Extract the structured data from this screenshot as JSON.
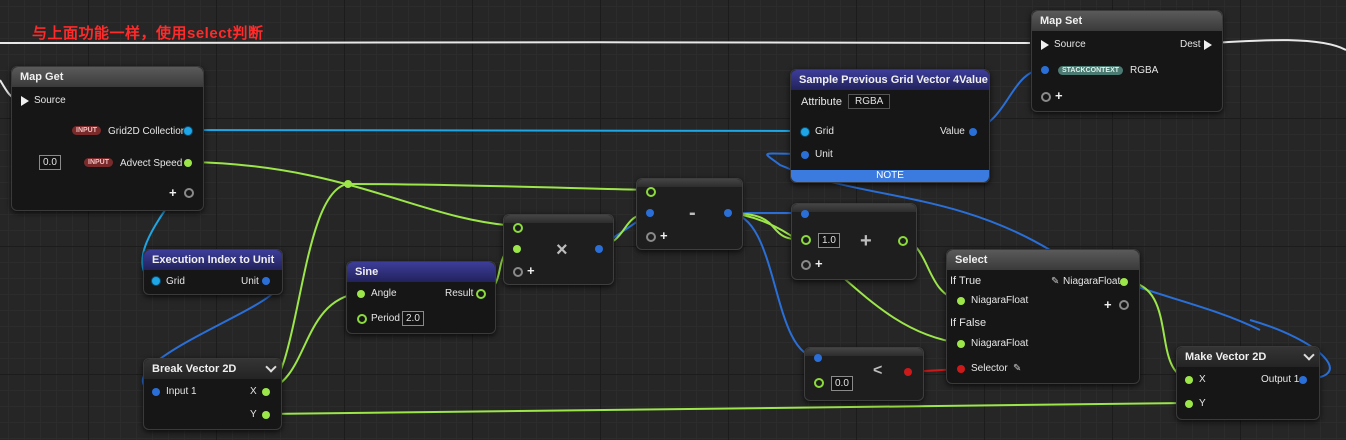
{
  "comment": "与上面功能一样，使用select判断",
  "map_get": {
    "title": "Map Get",
    "source": "Source",
    "input_badge": "INPUT",
    "grid_collection": "Grid2D Collection",
    "advect_speed": "Advect Speed",
    "advect_value": "0.0"
  },
  "exec_index": {
    "title": "Execution Index to Unit",
    "grid": "Grid",
    "unit": "Unit"
  },
  "break_vector": {
    "title": "Break Vector 2D",
    "input": "Input 1",
    "x": "X",
    "y": "Y"
  },
  "sine": {
    "title": "Sine",
    "angle": "Angle",
    "result": "Result",
    "period": "Period",
    "period_value": "2.0"
  },
  "multiply": {
    "symbol": "×"
  },
  "subtract": {
    "symbol": "-"
  },
  "add": {
    "symbol": "+",
    "value": "1.0"
  },
  "less": {
    "symbol": "<",
    "value": "0.0"
  },
  "sample": {
    "title": "Sample Previous Grid Vector 4Value",
    "attribute_label": "Attribute",
    "attribute_value": "RGBA",
    "grid": "Grid",
    "unit": "Unit",
    "value": "Value",
    "note": "NOTE"
  },
  "map_set": {
    "title": "Map Set",
    "source": "Source",
    "dest": "Dest",
    "stack_badge": "STACKCONTEXT",
    "rgba": "RGBA"
  },
  "select": {
    "title": "Select",
    "if_true": "If True",
    "if_false": "If False",
    "niagara_float": "NiagaraFloat",
    "selector": "Selector"
  },
  "make_vector": {
    "title": "Make Vector 2D",
    "x": "X",
    "y": "Y",
    "output": "Output 1"
  },
  "colors": {
    "float_pin": "#9ce64a",
    "struct_pin": "#1ea6e6",
    "bool_pin": "#cc1a1a",
    "comment_text": "#ff2a2a"
  }
}
